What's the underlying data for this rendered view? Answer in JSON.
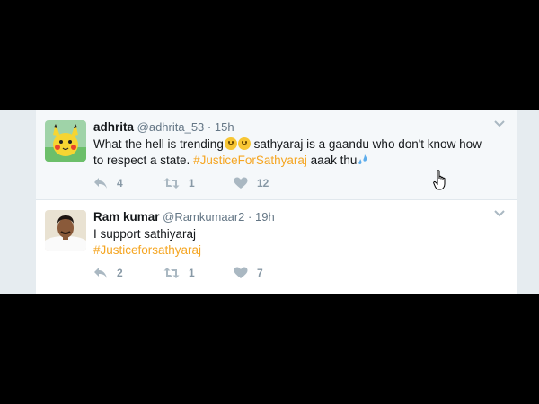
{
  "tweets": [
    {
      "fullname": "adhrita",
      "handle": "@adhrita_53",
      "separator": "·",
      "time": "15h",
      "text_part1": "What the hell is trending",
      "text_part2": " sathyaraj is a gaandu who don't know how to respect a state. ",
      "hashtag": "#JusticeForSathyaraj",
      "text_part3": " aaak thu",
      "reply_count": "4",
      "retweet_count": "1",
      "like_count": "12",
      "avatar_icon": "pikachu-avatar"
    },
    {
      "fullname": "Ram kumar",
      "handle": "@Ramkumaar2",
      "separator": "·",
      "time": "19h",
      "text_part1": "I support sathiyaraj",
      "hashtag": "#Justiceforsathyaraj",
      "reply_count": "2",
      "retweet_count": "1",
      "like_count": "7",
      "avatar_icon": "person-avatar"
    }
  ],
  "colors": {
    "hashtag": "#f5a623",
    "icon_gray": "#8899a6",
    "background": "#e6ecf0"
  }
}
